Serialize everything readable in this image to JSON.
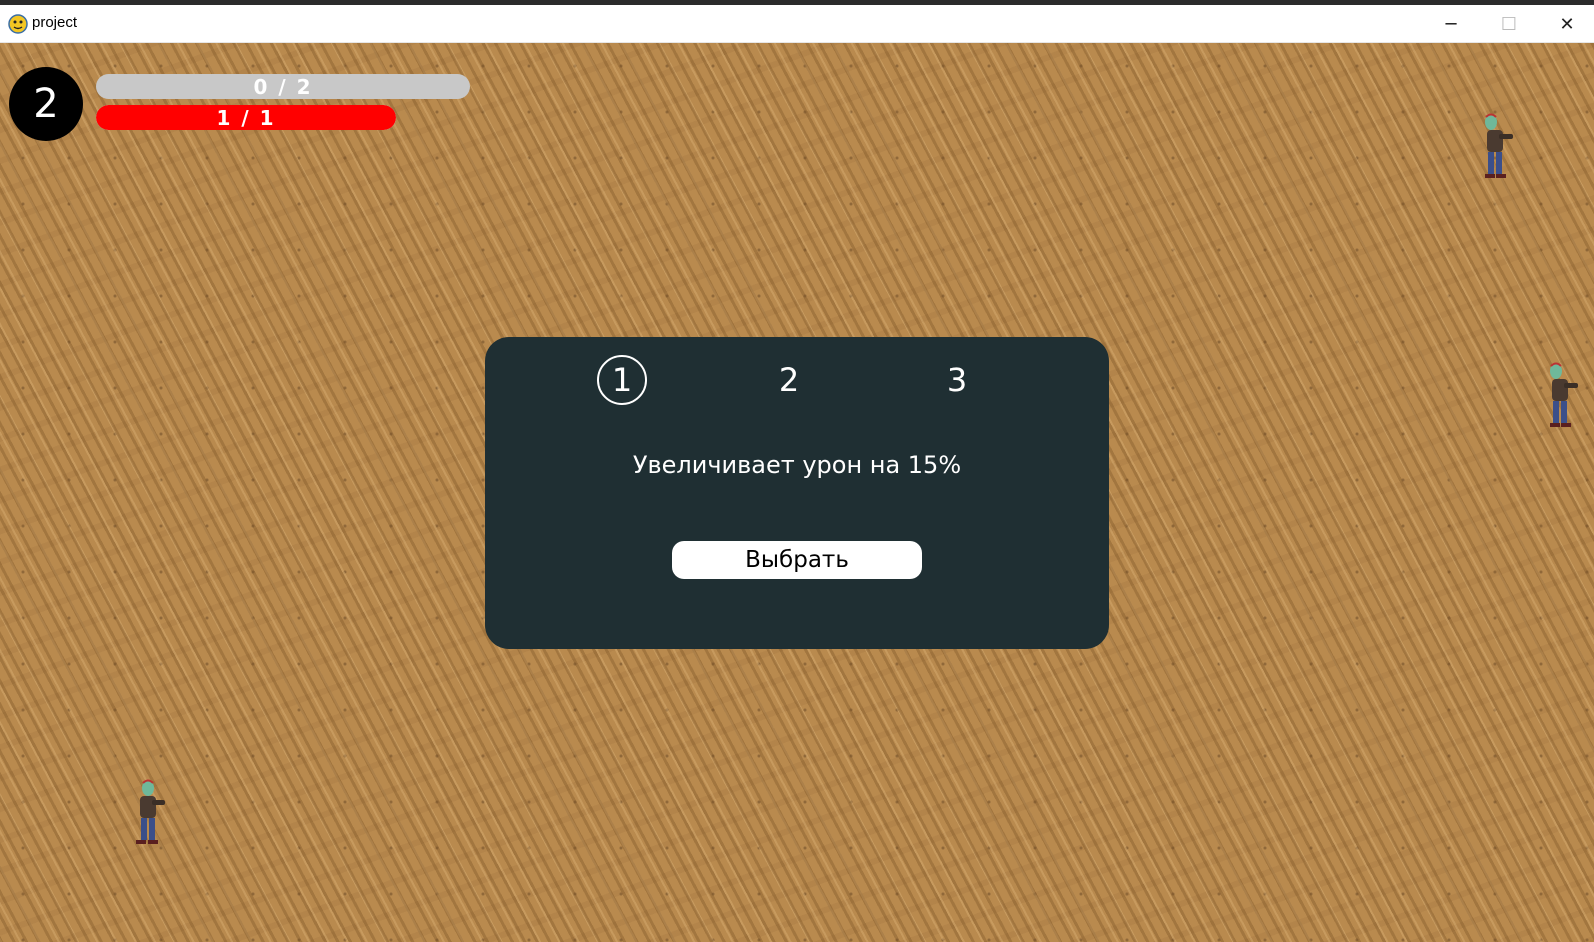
{
  "window": {
    "title": "project",
    "app_icon": "python-snake-icon",
    "controls": {
      "minimize": "─",
      "maximize": "☐",
      "close": "✕"
    }
  },
  "hud": {
    "level": "2",
    "xp": {
      "label": "0 / 2",
      "fraction": 0.0
    },
    "health": {
      "label": "1 / 1",
      "fraction": 1.0,
      "color": "#ff0000"
    }
  },
  "upgrade_dialog": {
    "tabs": [
      {
        "label": "1",
        "selected": true
      },
      {
        "label": "2",
        "selected": false
      },
      {
        "label": "3",
        "selected": false
      }
    ],
    "description": "Увеличивает урон на 15%",
    "button_label": "Выбрать",
    "background_color": "#1f2f33"
  },
  "enemies": [
    {
      "type": "zombie-icon"
    },
    {
      "type": "zombie-icon"
    },
    {
      "type": "zombie-icon"
    }
  ]
}
